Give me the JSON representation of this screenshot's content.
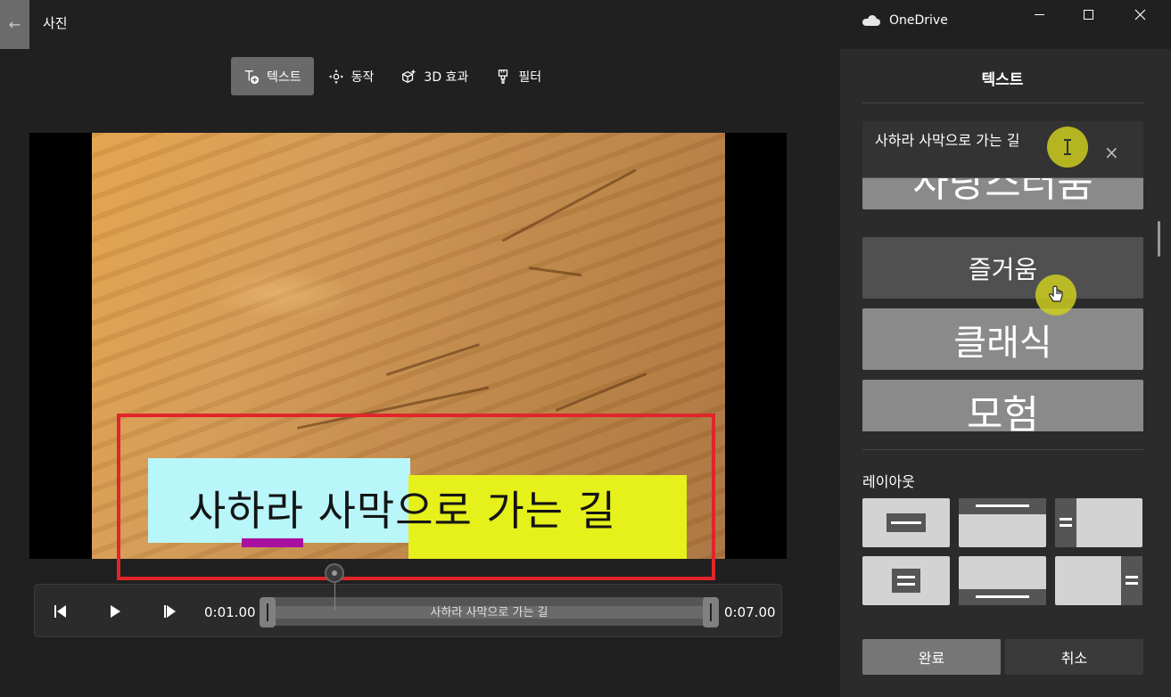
{
  "app": {
    "title": "사진",
    "back_glyph": "←"
  },
  "onedrive": {
    "label": "OneDrive"
  },
  "toolbar": {
    "items": [
      {
        "label": "텍스트",
        "active": true
      },
      {
        "label": "동작"
      },
      {
        "label": "3D 효과"
      },
      {
        "label": "필터"
      }
    ]
  },
  "preview": {
    "caption": "사하라 사막으로 가는 길",
    "caption_colors": {
      "left_bg": "#b8f6fa",
      "right_bg": "#e6f01a",
      "accent_bar": "#a810a0"
    },
    "highlight_color": "#e0252b"
  },
  "timeline": {
    "start_time": "0:01.00",
    "end_time": "0:07.00",
    "clip_label": "사하라 사막으로 가는 길"
  },
  "panel": {
    "title": "텍스트",
    "text_input_value": "사하라 사막으로 가는 길",
    "clear_glyph": "×",
    "styles": [
      {
        "label": "사랑스러움"
      },
      {
        "label": "즐거움"
      },
      {
        "label": "클래식"
      },
      {
        "label": "모험"
      }
    ],
    "layout_label": "레이아웃",
    "done_label": "완료",
    "cancel_label": "취소"
  }
}
